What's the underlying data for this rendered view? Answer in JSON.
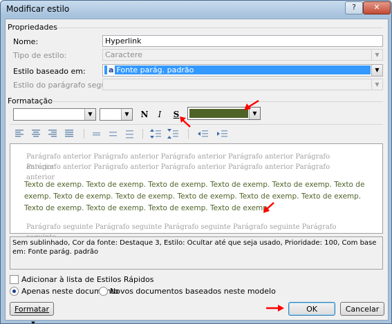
{
  "window": {
    "title": "Modificar estilo",
    "help_glyph": "?",
    "close_glyph": "✕"
  },
  "properties": {
    "section_title": "Propriedades",
    "name_label": "Nome:",
    "name_value": "Hyperlink",
    "style_type_label": "Tipo de estilo:",
    "style_type_value": "Caractere",
    "based_on_label": "Estilo baseado em:",
    "based_on_icon_text": "a",
    "based_on_value": "Fonte parág. padrão",
    "next_paragraph_label": "Estilo do parágrafo seguinte:",
    "next_paragraph_value": ""
  },
  "formatting": {
    "section_title": "Formatação",
    "font_value": "",
    "size_value": "",
    "bold_label": "N",
    "italic_label": "I",
    "underline_label": "S",
    "font_color": "#4f6228",
    "highlight_color": "#ff0000"
  },
  "preview": {
    "previous_line1": "Parágrafo anterior Parágrafo anterior Parágrafo anterior Parágrafo anterior Parágrafo anterior",
    "previous_line2": "Parágrafo anterior Parágrafo anterior Parágrafo anterior Parágrafo anterior Parágrafo anterior",
    "sample_line1": "Texto de exemp. Texto de exemp. Texto de exemp. Texto de exemp. Texto de exemp. Texto de",
    "sample_line2": "exemp. Texto de exemp. Texto de exemp. Texto de exemp. Texto de exemp. Texto de exemp.",
    "sample_line3": "Texto de exemp. Texto de exemp. Texto de exemp. Texto de exemp.",
    "following_line1": "Parágrafo seguinte Parágrafo seguinte Parágrafo seguinte Parágrafo seguinte Parágrafo seguinte"
  },
  "description": "Sem sublinhado, Cor da fonte: Destaque 3, Estilo: Ocultar até que seja usado, Prioridade: 100, Com base em: Fonte parág. padrão",
  "options": {
    "add_quick_styles_label": "Adicionar à lista de Estilos Rápidos",
    "this_document_label": "Apenas neste documento",
    "new_documents_label": "Novos documentos baseados neste modelo"
  },
  "buttons": {
    "format_label": "Formatar",
    "ok_label": "OK",
    "cancel_label": "Cancelar"
  }
}
